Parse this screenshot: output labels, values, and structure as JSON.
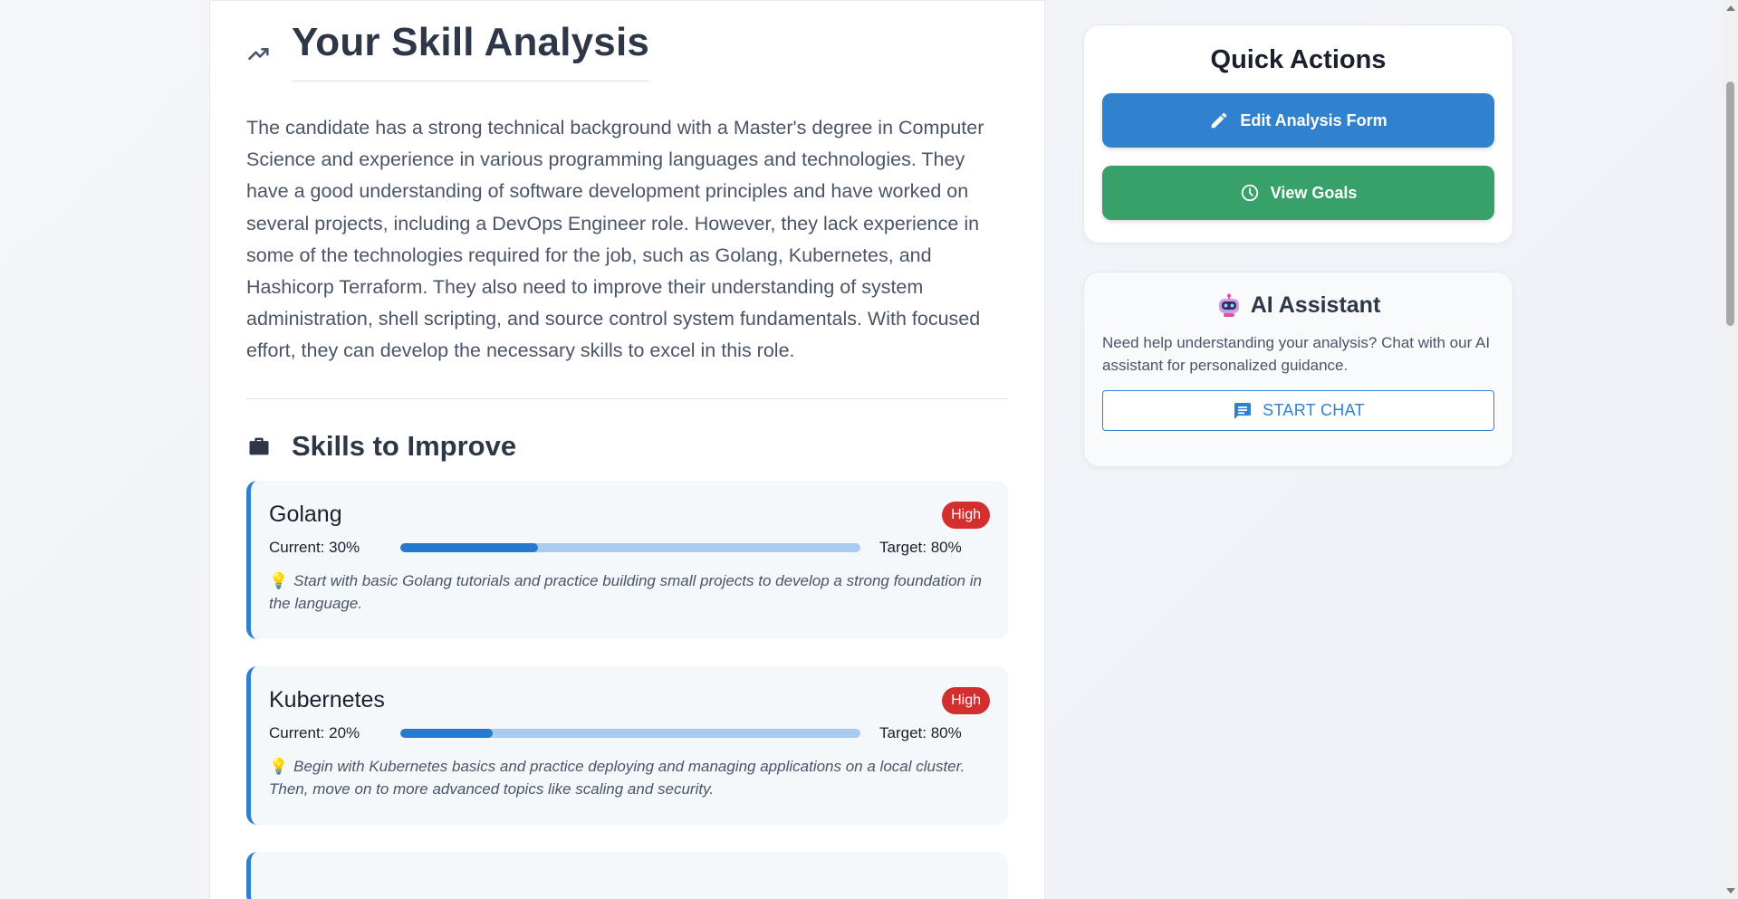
{
  "main": {
    "title": "Your Skill Analysis",
    "summary": "The candidate has a strong technical background with a Master's degree in Computer Science and experience in various programming languages and technologies. They have a good understanding of software development principles and have worked on several projects, including a DevOps Engineer role. However, they lack experience in some of the technologies required for the job, such as Golang, Kubernetes, and Hashicorp Terraform. They also need to improve their understanding of system administration, shell scripting, and source control system fundamentals. With focused effort, they can develop the necessary skills to excel in this role.",
    "skills_heading": "Skills to Improve",
    "skills": [
      {
        "name": "Golang",
        "priority": "High",
        "current_label": "Current: 30%",
        "current": 30,
        "target_label": "Target: 80%",
        "target": 80,
        "tip": "Start with basic Golang tutorials and practice building small projects to develop a strong foundation in the language."
      },
      {
        "name": "Kubernetes",
        "priority": "High",
        "current_label": "Current: 20%",
        "current": 20,
        "target_label": "Target: 80%",
        "target": 80,
        "tip": "Begin with Kubernetes basics and practice deploying and managing applications on a local cluster. Then, move on to more advanced topics like scaling and security."
      }
    ]
  },
  "sidebar": {
    "quick_actions": {
      "title": "Quick Actions",
      "edit_label": "Edit Analysis Form",
      "goals_label": "View Goals"
    },
    "ai_assistant": {
      "title": "AI Assistant",
      "description": "Need help understanding your analysis? Chat with our AI assistant for personalized guidance.",
      "chat_label": "START CHAT"
    }
  },
  "colors": {
    "primary": "#3182ce",
    "success": "#38a169",
    "danger": "#d32f2f",
    "progress_fill": "#2579cf",
    "progress_track": "#a8cbef"
  },
  "icons": [
    "trending-up-icon",
    "briefcase-icon",
    "lightbulb-icon",
    "pencil-icon",
    "clock-icon",
    "robot-icon",
    "chat-icon"
  ]
}
